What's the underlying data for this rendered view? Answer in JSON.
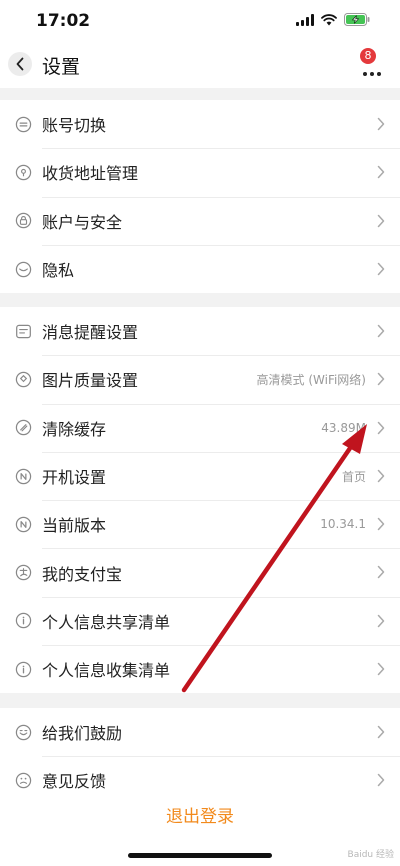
{
  "status_bar": {
    "time": "17:02",
    "battery_color": "#45c455"
  },
  "nav": {
    "title": "设置",
    "badge_count": "8",
    "back_icon": "chevron-left-icon",
    "more_icon": "more-dots-icon"
  },
  "groups": [
    {
      "rows": [
        {
          "label": "账号切换",
          "icon": "account-switch-icon",
          "value": ""
        },
        {
          "label": "收货地址管理",
          "icon": "location-pin-icon",
          "value": ""
        },
        {
          "label": "账户与安全",
          "icon": "lock-icon",
          "value": ""
        },
        {
          "label": "隐私",
          "icon": "eye-closed-icon",
          "value": ""
        }
      ]
    },
    {
      "rows": [
        {
          "label": "消息提醒设置",
          "icon": "message-settings-icon",
          "value": ""
        },
        {
          "label": "图片质量设置",
          "icon": "image-quality-icon",
          "value": "高清模式 (WiFi网络)"
        },
        {
          "label": "清除缓存",
          "icon": "clear-cache-icon",
          "value": "43.89M"
        },
        {
          "label": "开机设置",
          "icon": "startup-icon",
          "value": "首页"
        },
        {
          "label": "当前版本",
          "icon": "version-icon",
          "value": "10.34.1"
        },
        {
          "label": "我的支付宝",
          "icon": "alipay-icon",
          "value": ""
        },
        {
          "label": "个人信息共享清单",
          "icon": "info-icon",
          "value": ""
        },
        {
          "label": "个人信息收集清单",
          "icon": "info-icon",
          "value": ""
        }
      ]
    },
    {
      "rows": [
        {
          "label": "给我们鼓励",
          "icon": "smile-icon",
          "value": ""
        },
        {
          "label": "意见反馈",
          "icon": "feedback-icon",
          "value": ""
        }
      ]
    }
  ],
  "logout": {
    "label": "退出登录",
    "color": "#f28a1c"
  },
  "watermark": "Baidu 经验",
  "annotation_arrow_color": "#c0141e"
}
